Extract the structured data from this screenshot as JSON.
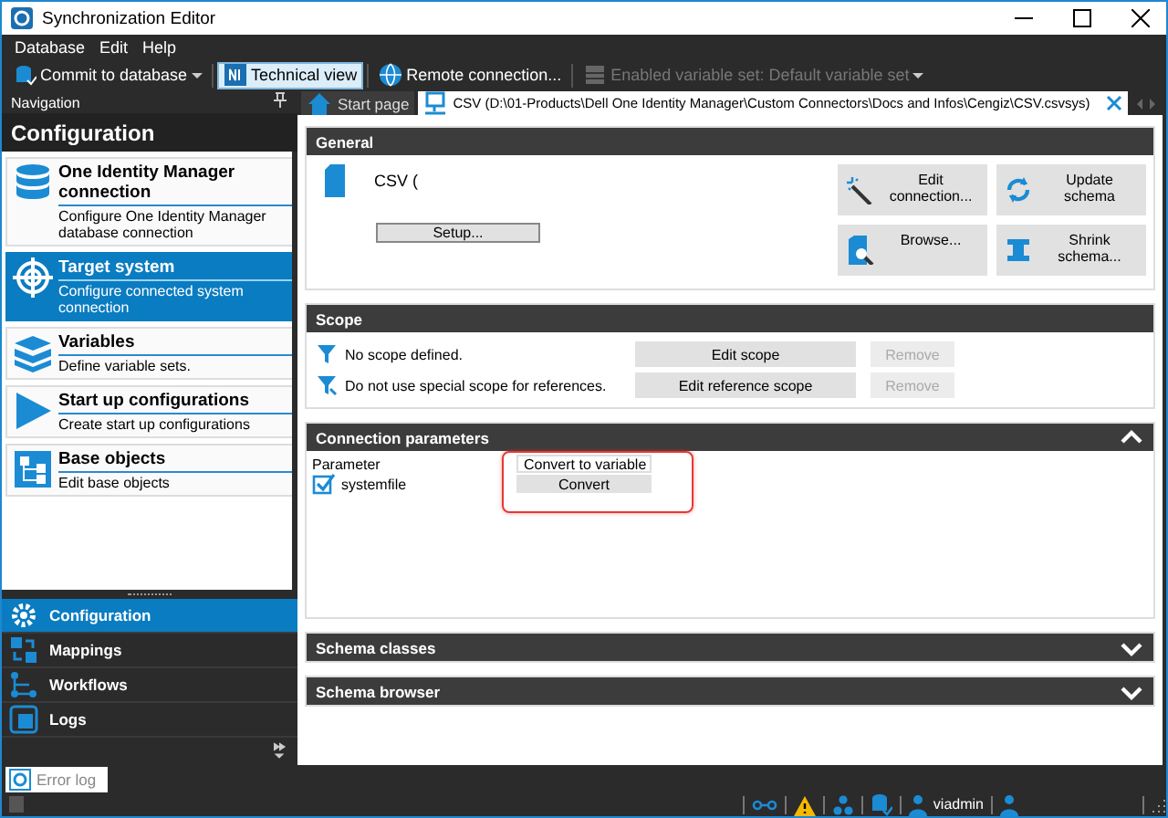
{
  "window": {
    "title": "Synchronization Editor"
  },
  "menu": [
    {
      "label": "Database"
    },
    {
      "label": "Edit"
    },
    {
      "label": "Help"
    }
  ],
  "toolbar": [
    {
      "label": "Commit to database",
      "kind": "commit",
      "dropdown": true,
      "selected": false,
      "disabled": false
    },
    {
      "label": "Technical view",
      "kind": "technical",
      "dropdown": false,
      "selected": true,
      "disabled": false
    },
    {
      "label": "Remote connection...",
      "kind": "globe",
      "dropdown": false,
      "selected": false,
      "disabled": false
    },
    {
      "label": "Enabled variable set: Default variable set",
      "kind": "varset",
      "dropdown": true,
      "selected": false,
      "disabled": true
    }
  ],
  "navigation": {
    "title": "Navigation",
    "heading": "Configuration",
    "items": [
      {
        "title": "One Identity Manager connection",
        "description": "Configure One Identity Manager database connection",
        "kind": "database",
        "selected": false
      },
      {
        "title": "Target system",
        "description": "Configure connected system connection",
        "kind": "target",
        "selected": true
      },
      {
        "title": "Variables",
        "description": "Define variable sets.",
        "kind": "layers",
        "selected": false
      },
      {
        "title": "Start up configurations",
        "description": "Create start up configurations",
        "kind": "play",
        "selected": false
      },
      {
        "title": "Base objects",
        "description": "Edit base objects",
        "kind": "objects",
        "selected": false
      }
    ],
    "sections": [
      {
        "label": "Configuration",
        "kind": "gear",
        "selected": true
      },
      {
        "label": "Mappings",
        "kind": "mappings",
        "selected": false
      },
      {
        "label": "Workflows",
        "kind": "workflows",
        "selected": false
      },
      {
        "label": "Logs",
        "kind": "logs",
        "selected": false
      }
    ]
  },
  "tabs": [
    {
      "label": "Start page",
      "kind": "home",
      "selected": false,
      "closable": false
    },
    {
      "label": "CSV (D:\\01-Products\\Dell One Identity Manager\\Custom Connectors\\Docs and Infos\\Cengiz\\CSV.csvsys)",
      "kind": "connection",
      "selected": true,
      "closable": true
    }
  ],
  "sections": [
    {
      "kind": "general",
      "title": "General",
      "name": "CSV (",
      "setup": "Setup...",
      "actions": [
        {
          "label": "Edit connection...",
          "kind": "wand"
        },
        {
          "label": "Update schema",
          "kind": "refresh"
        },
        {
          "label": "Browse...",
          "kind": "browse"
        },
        {
          "label": "Shrink schema...",
          "kind": "shrink"
        }
      ]
    },
    {
      "kind": "scope",
      "title": "Scope",
      "rows": [
        {
          "text": "No scope defined.",
          "kind": "filter",
          "button": "Edit scope",
          "remove": "Remove",
          "remove_disabled": true
        },
        {
          "text": "Do not use special scope for references.",
          "kind": "filter-ref",
          "button": "Edit reference scope",
          "remove": "Remove",
          "remove_disabled": true
        }
      ]
    },
    {
      "kind": "parameters",
      "title": "Connection parameters",
      "expanded": true,
      "columns": [
        "Parameter",
        "Convert to variable"
      ],
      "highlighted": true,
      "rows": [
        {
          "name": "systemfile",
          "action": "Convert"
        }
      ]
    },
    {
      "kind": "collapsed",
      "title": "Schema classes",
      "expanded": false
    },
    {
      "kind": "collapsed",
      "title": "Schema browser",
      "expanded": false
    }
  ],
  "error_log": {
    "label": "Error log"
  },
  "status_bar": {
    "user": "viadmin"
  }
}
